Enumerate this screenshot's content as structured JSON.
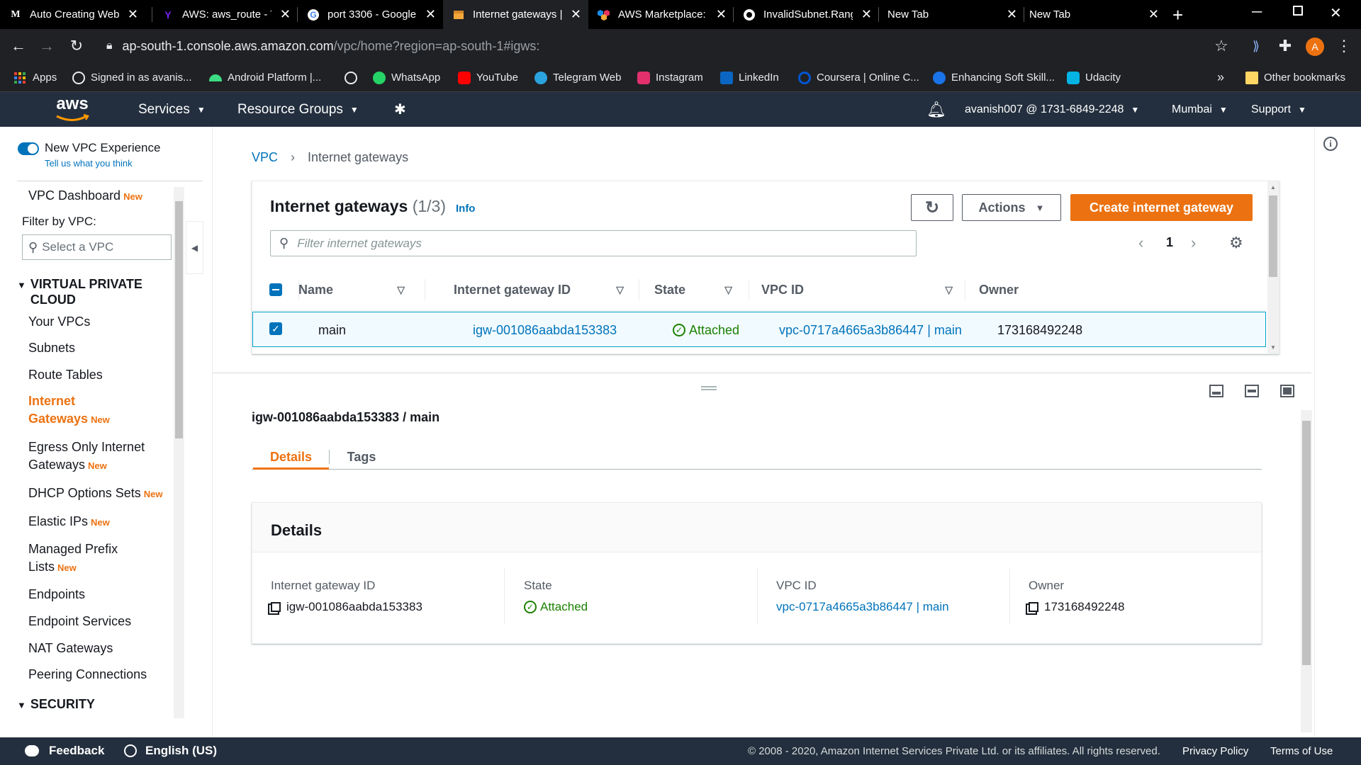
{
  "browser": {
    "tabs": [
      {
        "title": "Auto Creating Web",
        "icon": "gmail-icon"
      },
      {
        "title": "AWS: aws_route - T",
        "icon": "yahoo-icon"
      },
      {
        "title": "port 3306 - Google",
        "icon": "google-icon"
      },
      {
        "title": "Internet gateways | ",
        "icon": "aws-box-icon"
      },
      {
        "title": "AWS Marketplace:",
        "icon": "aws-marketplace-icon"
      },
      {
        "title": "InvalidSubnet.Rang",
        "icon": "github-icon"
      },
      {
        "title": "New Tab",
        "icon": ""
      },
      {
        "title": "New Tab",
        "icon": ""
      }
    ],
    "url_host": "ap-south-1.console.aws.amazon.com",
    "url_path": "/vpc/home?region=ap-south-1#igws:",
    "profile_initial": "A",
    "bookmarks": [
      {
        "label": "Apps",
        "color": "#ea4335"
      },
      {
        "label": "Signed in as avanis...",
        "color": "#e8eaed"
      },
      {
        "label": "Android Platform |...",
        "color": "#3ddc84"
      },
      {
        "label": "",
        "color": "#e8eaed"
      },
      {
        "label": "WhatsApp",
        "color": "#25d366"
      },
      {
        "label": "YouTube",
        "color": "#ff0000"
      },
      {
        "label": "Telegram Web",
        "color": "#2aa3df"
      },
      {
        "label": "Instagram",
        "color": "#e1306c"
      },
      {
        "label": "LinkedIn",
        "color": "#0a66c2"
      },
      {
        "label": "Coursera | Online C...",
        "color": "#0056d2"
      },
      {
        "label": "Enhancing Soft Skill...",
        "color": "#1a73e8"
      },
      {
        "label": "Udacity",
        "color": "#02b3e4"
      }
    ],
    "overflow": "»",
    "other_bookmarks": "Other bookmarks"
  },
  "aws_header": {
    "logo": "aws",
    "services": "Services",
    "resource_groups": "Resource Groups",
    "account": "avanish007 @ 1731-6849-2248",
    "region": "Mumbai",
    "support": "Support"
  },
  "sidenav": {
    "toggle_label": "New VPC Experience",
    "toggle_sub": "Tell us what you think",
    "dashboard": "VPC Dashboard",
    "new_tag": "New",
    "filter_label": "Filter by VPC:",
    "filter_placeholder": "Select a VPC",
    "section_vpc": "VIRTUAL PRIVATE CLOUD",
    "items": [
      "Your VPCs",
      "Subnets",
      "Route Tables"
    ],
    "active_line1": "Internet",
    "active_line2": "Gateways",
    "egress_line1": "Egress Only Internet",
    "egress_line2": "Gateways",
    "dhcp": "DHCP Options Sets",
    "eips": "Elastic IPs",
    "prefix_line1": "Managed Prefix",
    "prefix_line2": "Lists",
    "items2": [
      "Endpoints",
      "Endpoint Services",
      "NAT Gateways",
      "Peering Connections"
    ],
    "section_security": "SECURITY"
  },
  "breadcrumb": {
    "root": "VPC",
    "current": "Internet gateways"
  },
  "table_panel": {
    "title": "Internet gateways",
    "count": "(1/3)",
    "info": "Info",
    "actions": "Actions",
    "create": "Create internet gateway",
    "filter_placeholder": "Filter internet gateways",
    "page": "1",
    "columns": [
      "Name",
      "Internet gateway ID",
      "State",
      "VPC ID",
      "Owner"
    ],
    "rows": [
      {
        "name": "main",
        "id": "igw-001086aabda153383",
        "state": "Attached",
        "vpc": "vpc-0717a4665a3b86447 | main",
        "owner": "173168492248"
      }
    ]
  },
  "detail": {
    "title": "igw-001086aabda153383 / main",
    "tabs": [
      "Details",
      "Tags"
    ],
    "section": "Details",
    "fields": [
      {
        "label": "Internet gateway ID",
        "value": "igw-001086aabda153383"
      },
      {
        "label": "State",
        "value": "Attached"
      },
      {
        "label": "VPC ID",
        "value": "vpc-0717a4665a3b86447 | main"
      },
      {
        "label": "Owner",
        "value": "173168492248"
      }
    ]
  },
  "footer": {
    "feedback": "Feedback",
    "language": "English (US)",
    "copyright": "© 2008 - 2020, Amazon Internet Services Private Ltd. or its affiliates. All rights reserved.",
    "privacy": "Privacy Policy",
    "terms": "Terms of Use"
  },
  "colors": {
    "aws_orange": "#ec7211",
    "aws_link": "#0073bb",
    "aws_nav": "#232f3e",
    "success": "#1d8102"
  }
}
